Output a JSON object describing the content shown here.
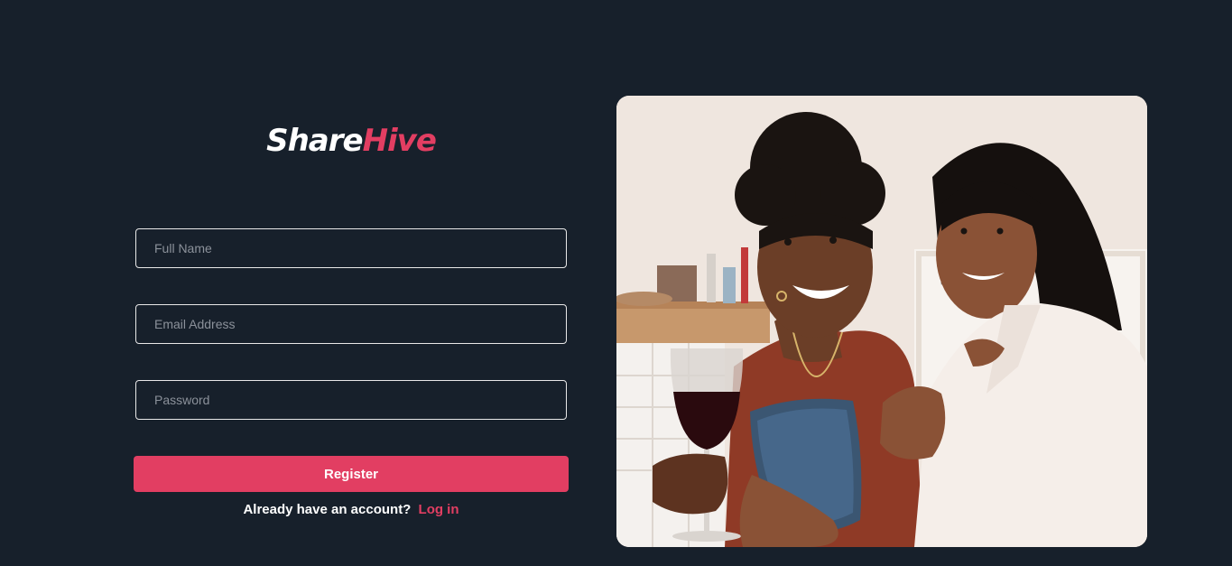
{
  "brand": {
    "part1": "Share",
    "part2": "Hive",
    "accent_color": "#e23e62",
    "background_color": "#17202b"
  },
  "form": {
    "full_name_placeholder": "Full Name",
    "email_placeholder": "Email Address",
    "password_placeholder": "Password",
    "full_name_value": "",
    "email_value": "",
    "password_value": "",
    "submit_label": "Register"
  },
  "footer": {
    "prompt": "Already have an account?",
    "login_link": "Log in"
  },
  "hero_image": {
    "subject": "two-women-smiling-at-phone"
  }
}
